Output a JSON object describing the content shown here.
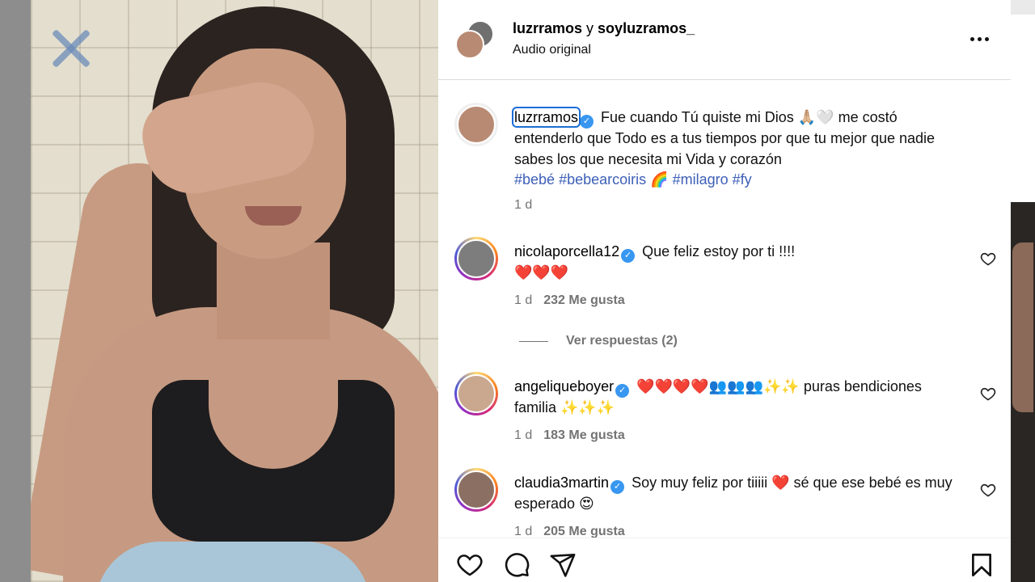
{
  "post": {
    "header": {
      "author1": "luzrramos",
      "conjunction": " y ",
      "author2": "soyluzramos_",
      "subtitle": "Audio original",
      "more_icon": "more-horizontal-icon"
    },
    "caption": {
      "username": "luzrramos",
      "text": " Fue cuando Tú quiste mi Dios 🙏🏼🤍 me costó entenderlo que Todo es a tus tiempos por que tu mejor que nadie sabes los que necesita mi Vida y corazón",
      "hashtag1": "#bebé",
      "hashtag2": "#bebearcoiris",
      "rainbow": " 🌈 ",
      "hashtag3": "#milagro",
      "hashtag4": "#fy",
      "time": "1 d"
    },
    "comments": [
      {
        "username": "nicolaporcella12",
        "text": " Que feliz estoy por ti !!!!",
        "text2": "❤️❤️❤️",
        "time": "1 d",
        "likes": "232 Me gusta"
      },
      {
        "username": "angeliqueboyer",
        "text": " ❤️❤️❤️❤️👥👥👥✨✨ puras bendiciones familia ✨✨✨",
        "time": "1 d",
        "likes": "183 Me gusta"
      },
      {
        "username": "claudia3martin",
        "text": " Soy muy feliz por tiiiii ❤️ sé que ese bebé es muy esperado 😍",
        "time": "1 d",
        "likes": "205 Me gusta"
      }
    ],
    "view_replies": "Ver respuestas (2)",
    "actions": [
      "like-icon",
      "comment-icon",
      "share-icon",
      "save-icon"
    ]
  },
  "colors": {
    "verified": "#3897f0",
    "hashtag": "#3d5fb8",
    "muted": "#737373",
    "focus": "#1a6fd6"
  }
}
